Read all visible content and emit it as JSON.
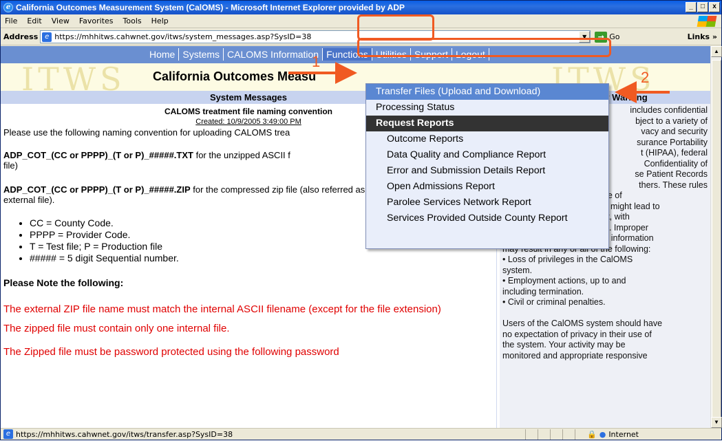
{
  "window": {
    "title": "California Outcomes Measurement System (CalOMS) - Microsoft Internet Explorer provided by ADP",
    "min": "_",
    "max": "□",
    "close": "x"
  },
  "menu": [
    "File",
    "Edit",
    "View",
    "Favorites",
    "Tools",
    "Help"
  ],
  "address": {
    "label": "Address",
    "url": "https://mhhitws.cahwnet.gov/itws/system_messages.asp?SysID=38",
    "go": "Go",
    "links": "Links"
  },
  "nav": [
    "Home",
    "Systems",
    "CALOMS Information",
    "Functions",
    "Utilities",
    "Support",
    "Logout"
  ],
  "banner": {
    "watermark": "ITWS",
    "title": "California Outcomes Measu"
  },
  "left": {
    "heading": "System Messages",
    "msg_title": "CALOMS treatment file naming convention",
    "msg_created": "Created: 10/9/2005 3:49:00 PM",
    "para1": "Please use the following naming convention for uploading CALOMS  trea",
    "para2_bold": "ADP_COT_(CC or PPPP)_(T or P)_#####.TXT",
    "para2_rest": " for the unzipped ASCII f",
    "para2_tail": "file)",
    "para3_bold": "ADP_COT_(CC or PPPP)_(T or P)_#####.ZIP",
    "para3_rest": " for the compressed  zip file (also referred as",
    "para3_tail": "external file).",
    "bullets": [
      "CC = County Code.",
      "PPPP = Provider Code.",
      "T = Test file; P = Production file",
      "##### = 5 digit Sequential number."
    ],
    "note_heading": "Please Note the following:",
    "red1": "The external ZIP file name must match the internal ASCII filename (except for the file extension)",
    "red2": "The zipped file must contain only one internal file.",
    "red3": "The Zipped file must be password protected using the following password"
  },
  "right": {
    "heading": "ty Warning",
    "lines": [
      "includes confidential",
      "bject to a variety of",
      "vacy and security",
      "surance Portability",
      "t (HIPAA), federal",
      "Confidentiality of",
      "se Patient Records",
      "thers. These rules",
      "prohibit the disclosure or use of",
      "information that identifies or might lead to",
      "the identification of a patient, with",
      "narrowly defined exceptions. Improper",
      "access, disclosure or use of information",
      "may result in any or all of the following:",
      "• Loss of privileges in the CalOMS",
      "system.",
      "• Employment actions, up to and",
      "including termination.",
      "• Civil or criminal penalties.",
      "",
      "Users of the CalOMS system should have",
      "no expectation of privacy in their use of",
      "the system. Your activity may be",
      "monitored and appropriate responsive"
    ]
  },
  "dropdown": {
    "items": [
      {
        "label": "Transfer Files (Upload and Download)",
        "kind": "active"
      },
      {
        "label": "Processing Status",
        "kind": "item"
      },
      {
        "label": "Request Reports",
        "kind": "header"
      },
      {
        "label": "Outcome Reports",
        "kind": "sub"
      },
      {
        "label": "Data Quality and Compliance Report",
        "kind": "sub"
      },
      {
        "label": "Error and Submission Details Report",
        "kind": "sub"
      },
      {
        "label": "Open Admissions Report",
        "kind": "sub"
      },
      {
        "label": "Parolee Services Network Report",
        "kind": "sub"
      },
      {
        "label": "Services Provided Outside County Report",
        "kind": "sub"
      }
    ]
  },
  "annotations": {
    "one": "1",
    "two": "2",
    "color": "#f05a22"
  },
  "status": {
    "url": "https://mhhitws.cahwnet.gov/itws/transfer.asp?SysID=38",
    "zone": "Internet"
  }
}
